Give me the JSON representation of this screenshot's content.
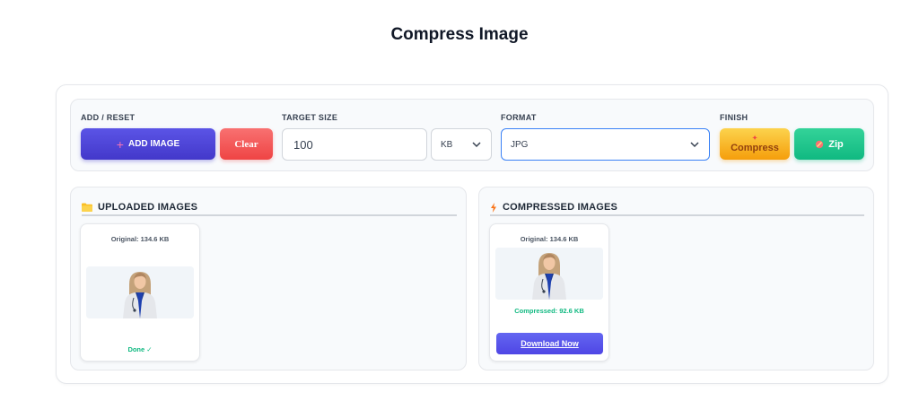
{
  "page": {
    "title": "Compress Image"
  },
  "toolbar": {
    "add_reset_label": "ADD / RESET",
    "add_image_label": "ADD IMAGE",
    "clear_label": "Clear",
    "target_size_label": "TARGET SIZE",
    "target_size_value": "100",
    "unit_value": "KB",
    "format_label": "FORMAT",
    "format_value": "JPG",
    "finish_label": "FINISH",
    "compress_label": "Compress",
    "zip_label": "Zip"
  },
  "uploaded": {
    "header": "UPLOADED IMAGES",
    "items": [
      {
        "original": "Original: 134.6 KB",
        "status": "Done ✓"
      }
    ]
  },
  "compressed": {
    "header": "COMPRESSED IMAGES",
    "items": [
      {
        "original": "Original: 134.6 KB",
        "compressed": "Compressed: 92.6 KB",
        "download_label": "Download Now"
      }
    ]
  },
  "icons": {
    "folder": "folder-icon",
    "lightning": "lightning-icon",
    "plus": "plus-icon",
    "chevron": "chevron-down-icon",
    "spark": "spark-icon",
    "zip": "zip-icon"
  },
  "colors": {
    "primary": "#4338ca",
    "danger": "#ef4444",
    "warning": "#f59e0b",
    "success": "#10b981",
    "download": "#4f46e5"
  }
}
